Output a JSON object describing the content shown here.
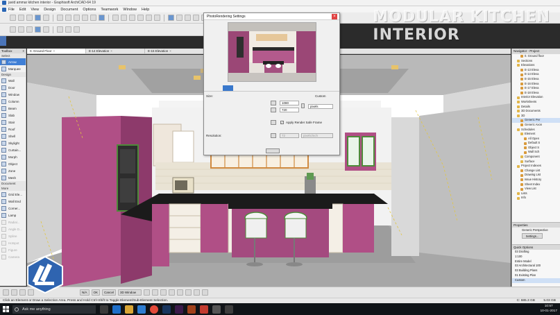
{
  "window": {
    "title": "javid ammar kitchen interior - Graphisoft ArchiCAD-64 19"
  },
  "menu": [
    "File",
    "Edit",
    "View",
    "Design",
    "Document",
    "Options",
    "Teamwork",
    "Window",
    "Help"
  ],
  "watermark": {
    "line1": "MODULAR KITCHEN",
    "line2": "INTERIOR"
  },
  "infobox_tab": "Info Box",
  "toolbox": {
    "title": "Toolbox",
    "groups": {
      "select": "Select",
      "design": "Design",
      "document": "Document",
      "more": "More"
    },
    "select_tools": [
      {
        "label": "Arrow",
        "icon": "arrow-icon",
        "selected": true
      },
      {
        "label": "Marquee",
        "icon": "marquee-icon"
      }
    ],
    "design_tools": [
      {
        "label": "Wall",
        "icon": "wall-icon"
      },
      {
        "label": "Door",
        "icon": "door-icon"
      },
      {
        "label": "Window",
        "icon": "window-icon"
      },
      {
        "label": "Column",
        "icon": "column-icon"
      },
      {
        "label": "Beam",
        "icon": "beam-icon"
      },
      {
        "label": "Slab",
        "icon": "slab-icon"
      },
      {
        "label": "Stair",
        "icon": "stair-icon"
      },
      {
        "label": "Roof",
        "icon": "roof-icon"
      },
      {
        "label": "Shell",
        "icon": "shell-icon"
      },
      {
        "label": "Skylight",
        "icon": "skylight-icon"
      },
      {
        "label": "Curtain...",
        "icon": "curtain-wall-icon"
      },
      {
        "label": "Morph",
        "icon": "morph-icon"
      },
      {
        "label": "Object",
        "icon": "object-icon"
      },
      {
        "label": "Zone",
        "icon": "zone-icon"
      },
      {
        "label": "Mesh",
        "icon": "mesh-icon"
      }
    ],
    "more_tools": [
      {
        "label": "Grid Ele...",
        "icon": "grid-element-icon"
      },
      {
        "label": "Wall End",
        "icon": "wall-end-icon"
      },
      {
        "label": "Corner...",
        "icon": "corner-window-icon"
      },
      {
        "label": "Lamp",
        "icon": "lamp-icon"
      },
      {
        "label": "Radial...",
        "icon": "radial-dimension-icon",
        "disabled": true
      },
      {
        "label": "Angle D...",
        "icon": "angle-dimension-icon",
        "disabled": true
      },
      {
        "label": "Spline",
        "icon": "spline-icon",
        "disabled": true
      },
      {
        "label": "Hotspot",
        "icon": "hotspot-icon",
        "disabled": true
      },
      {
        "label": "Figure",
        "icon": "figure-icon",
        "disabled": true
      },
      {
        "label": "Camera",
        "icon": "camera-icon",
        "disabled": true
      }
    ]
  },
  "tabs": [
    {
      "label": "0. Ground Floor"
    },
    {
      "label": "E-14 Elevation"
    },
    {
      "label": "E-15 Elevation"
    },
    {
      "label": ""
    }
  ],
  "dialog": {
    "title": "PhotoRendering Settings",
    "size_label": "Size:",
    "size_preset": "Custom",
    "width_value": "1080",
    "height_value": "720",
    "unit": "pixels",
    "safe_frame_label": "Apply Render Safe Frame",
    "resolution_label": "Resolution:",
    "resolution_value": "72",
    "resolution_unit": "pixels/inch"
  },
  "navigator": {
    "title": "Navigator - Project",
    "items": [
      {
        "label": "0. Ground floor",
        "indent": 2,
        "folder": false
      },
      {
        "label": "Sections",
        "indent": 1,
        "folder": true
      },
      {
        "label": "Elevations",
        "indent": 1,
        "folder": true
      },
      {
        "label": "E-13 Eleva",
        "indent": 2
      },
      {
        "label": "E-14 Eleva",
        "indent": 2
      },
      {
        "label": "E-15 Eleva",
        "indent": 2
      },
      {
        "label": "E-16 Eleva",
        "indent": 2
      },
      {
        "label": "E-17 Eleva",
        "indent": 2
      },
      {
        "label": "E-18 Eleva",
        "indent": 2
      },
      {
        "label": "Interior Elevation",
        "indent": 1,
        "folder": true
      },
      {
        "label": "Worksheets",
        "indent": 1,
        "folder": true
      },
      {
        "label": "Details",
        "indent": 1,
        "folder": true
      },
      {
        "label": "3D Documents",
        "indent": 1,
        "folder": true
      },
      {
        "label": "3D",
        "indent": 1,
        "folder": true
      },
      {
        "label": "Generic Per",
        "indent": 2,
        "selected": true
      },
      {
        "label": "Generic Axon",
        "indent": 2
      },
      {
        "label": "Schedules",
        "indent": 1,
        "folder": true
      },
      {
        "label": "Element",
        "indent": 2,
        "folder": true
      },
      {
        "label": "All Open",
        "indent": 3
      },
      {
        "label": "Default S",
        "indent": 3
      },
      {
        "label": "Object S",
        "indent": 3
      },
      {
        "label": "Wall Sch",
        "indent": 3
      },
      {
        "label": "Component",
        "indent": 2,
        "folder": true
      },
      {
        "label": "Surface",
        "indent": 2,
        "folder": true
      },
      {
        "label": "Project Indexes",
        "indent": 1,
        "folder": true
      },
      {
        "label": "Change List",
        "indent": 2
      },
      {
        "label": "Drawing List",
        "indent": 2
      },
      {
        "label": "Issue History",
        "indent": 2
      },
      {
        "label": "Sheet Index",
        "indent": 2
      },
      {
        "label": "View List",
        "indent": 2
      },
      {
        "label": "Lists",
        "indent": 1,
        "folder": true
      },
      {
        "label": "Info",
        "indent": 1,
        "folder": true
      }
    ]
  },
  "properties": {
    "title": "Properties",
    "value": "Generic Perspective",
    "settings_button": "Settings..."
  },
  "quick_options": {
    "title": "Quick Options",
    "items": [
      {
        "label": "03 Drafting"
      },
      {
        "label": "1:100"
      },
      {
        "label": "Entire Model"
      },
      {
        "label": "03 Architectural 100"
      },
      {
        "label": "03 Building Plans"
      },
      {
        "label": "01 Existing Plan"
      },
      {
        "label": "Custom",
        "selected": true
      }
    ]
  },
  "bottombar": {
    "zoom_label": "N/A",
    "ok_label": "OK",
    "cancel_label": "Cancel",
    "view_label": "3D Window"
  },
  "status": {
    "text": "Click an Element or Draw a Selection Area. Press and Hold Ctrl+Shift to Toggle Element/Sub-Element Selection.",
    "disk1": "C: 685.3 GB",
    "disk2": "5.03 GB"
  },
  "taskbar": {
    "search_placeholder": "Ask me anything",
    "time": "10:57",
    "date": "10-01-2017"
  },
  "colors": {
    "cabinet_magenta": "#b04f86",
    "cabinet_dark": "#8d3a6b",
    "countertop": "#1b1b1b",
    "window_green": "#4e8a3a",
    "selection_blue": "#3f7fd6",
    "close_red": "#e04343"
  }
}
